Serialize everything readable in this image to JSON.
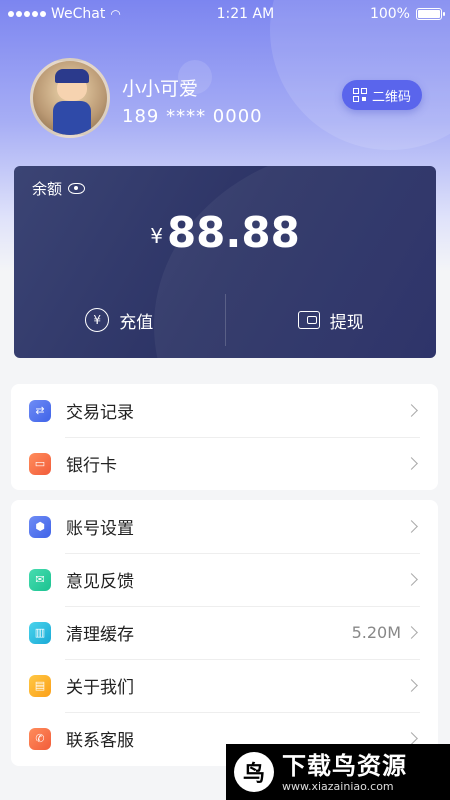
{
  "status_bar": {
    "carrier": "WeChat",
    "time": "1:21 AM",
    "battery": "100%"
  },
  "profile": {
    "username": "小小可爱",
    "phone": "189 **** 0000",
    "qr_label": "二维码"
  },
  "balance": {
    "label": "余额",
    "currency": "¥",
    "amount": "88.88",
    "recharge_label": "充值",
    "withdraw_label": "提现"
  },
  "menu_group_1": [
    {
      "label": "交易记录",
      "icon": "exchange-icon",
      "color": "#4f6ff0"
    },
    {
      "label": "银行卡",
      "icon": "card-icon",
      "color": "#f46c44"
    }
  ],
  "menu_group_2": [
    {
      "label": "账号设置",
      "icon": "settings-icon",
      "color": "#4f6ff0"
    },
    {
      "label": "意见反馈",
      "icon": "mail-icon",
      "color": "#2ccc9c"
    },
    {
      "label": "清理缓存",
      "icon": "trash-icon",
      "color": "#2ab9e0",
      "value": "5.20M"
    },
    {
      "label": "关于我们",
      "icon": "info-icon",
      "color": "#fcac23"
    },
    {
      "label": "联系客服",
      "icon": "phone-icon",
      "color": "#f46c44"
    }
  ],
  "watermark": {
    "title": "下载鸟资源",
    "url": "www.xiazainiao.com"
  },
  "colors": {
    "accent": "#5a65ec",
    "card_bg": "#2d3466"
  }
}
